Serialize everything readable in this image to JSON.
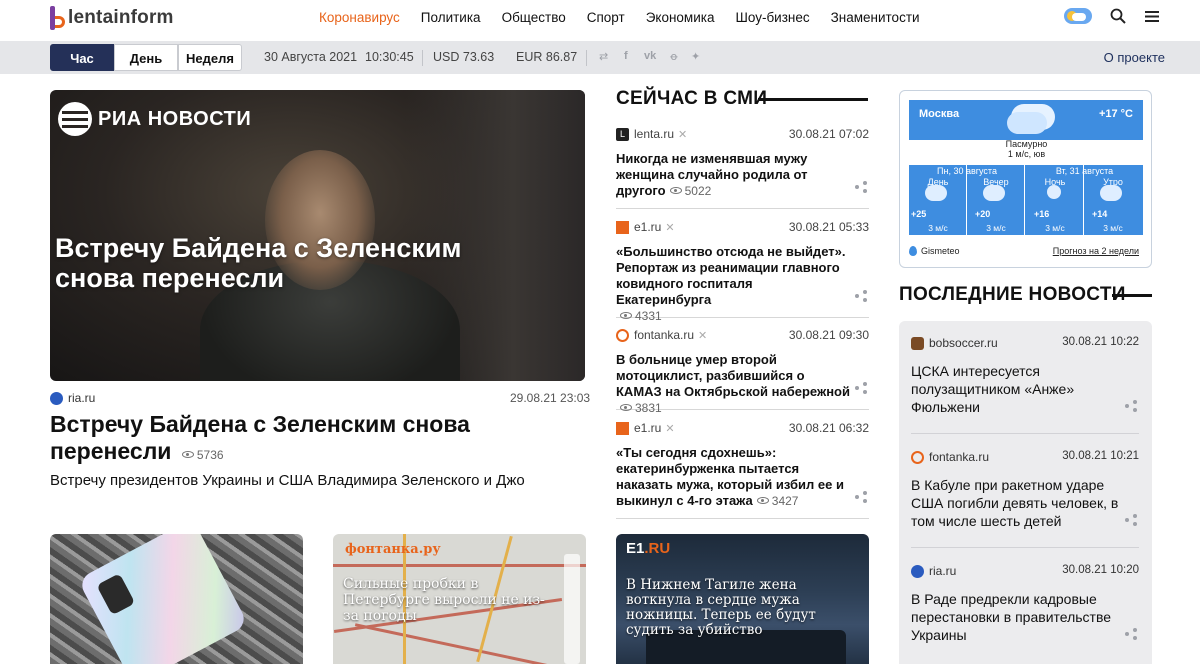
{
  "header": {
    "logo_text": "lentainform",
    "nav": [
      "Коронавирус",
      "Политика",
      "Общество",
      "Спорт",
      "Экономика",
      "Шоу-бизнес",
      "Знаменитости"
    ]
  },
  "toolbar": {
    "tabs": [
      "Час",
      "День",
      "Неделя"
    ],
    "date": "30 Августа 2021",
    "time": "10:30:45",
    "usd": "USD 73.63",
    "eur": "EUR 86.87",
    "about": "О проекте"
  },
  "hero": {
    "image_logo": "РИА НОВОСТИ",
    "image_caption": "Встречу Байдена с Зеленским снова перенесли",
    "source": "ria.ru",
    "date": "29.08.21 23:03",
    "title": "Встречу Байдена с Зеленским снова перенесли",
    "views": "5736",
    "lead": "Встречу президентов Украины и США Владимира Зеленского и Джо"
  },
  "thumbs": [
    {
      "caption": ""
    },
    {
      "logo": "фонтанка.ру",
      "caption": "Сильные пробки в Петербурге выросли не из-за погоды"
    },
    {
      "logo_a": "E1",
      "logo_b": ".RU",
      "caption": "В Нижнем Тагиле жена воткнула в сердце мужа ножницы. Теперь ее будут судить за убийство"
    }
  ],
  "now_in_media": {
    "title": "СЕЙЧАС В СМИ",
    "items": [
      {
        "source": "lenta.ru",
        "date": "30.08.21 07:02",
        "title": "Никогда не изменявшая мужу женщина случайно родила от другого",
        "views": "5022"
      },
      {
        "source": "e1.ru",
        "date": "30.08.21 05:33",
        "title": "«Большинство отсюда не выйдет». Репортаж из реанимации главного ковидного госпиталя Екатеринбурга",
        "views": "4331"
      },
      {
        "source": "fontanka.ru",
        "date": "30.08.21 09:30",
        "title": "В больнице умер второй мотоциклист, разбившийся о КАМАЗ на Октябрьской набережной",
        "views": "3831"
      },
      {
        "source": "e1.ru",
        "date": "30.08.21 06:32",
        "title": "«Ты сегодня сдохнешь»: екатеринбурженка пытается наказать мужа, который избил ее и выкинул с 4-го этажа",
        "views": "3427"
      }
    ]
  },
  "weather": {
    "city": "Москва",
    "temp": "+17 °C",
    "desc": "Пасмурно",
    "wind": "1 м/с, юв",
    "day1": "Пн, 30 августа",
    "day2": "Вт, 31 августа",
    "parts": [
      {
        "label": "День",
        "temp": "+25",
        "wind": "3 м/с"
      },
      {
        "label": "Вечер",
        "temp": "+20",
        "wind": "3 м/с"
      },
      {
        "label": "Ночь",
        "temp": "+16",
        "wind": "3 м/с"
      },
      {
        "label": "Утро",
        "temp": "+14",
        "wind": "3 м/с"
      }
    ],
    "provider": "Gismeteo",
    "forecast_link": "Прогноз на 2 недели"
  },
  "latest": {
    "title": "ПОСЛЕДНИЕ НОВОСТИ",
    "items": [
      {
        "source": "bobsoccer.ru",
        "date": "30.08.21 10:22",
        "title": "ЦСКА интересуется полузащитником «Анже» Фюльжени"
      },
      {
        "source": "fontanka.ru",
        "date": "30.08.21 10:21",
        "title": "В Кабуле при ракетном ударе США погибли девять человек, в том числе шесть детей"
      },
      {
        "source": "ria.ru",
        "date": "30.08.21 10:20",
        "title": "В Раде предрекли кадровые перестановки в правительстве Украины"
      }
    ]
  },
  "colors": {
    "accent": "#e8641b",
    "navy": "#243058",
    "weather_blue": "#3e8de0"
  }
}
